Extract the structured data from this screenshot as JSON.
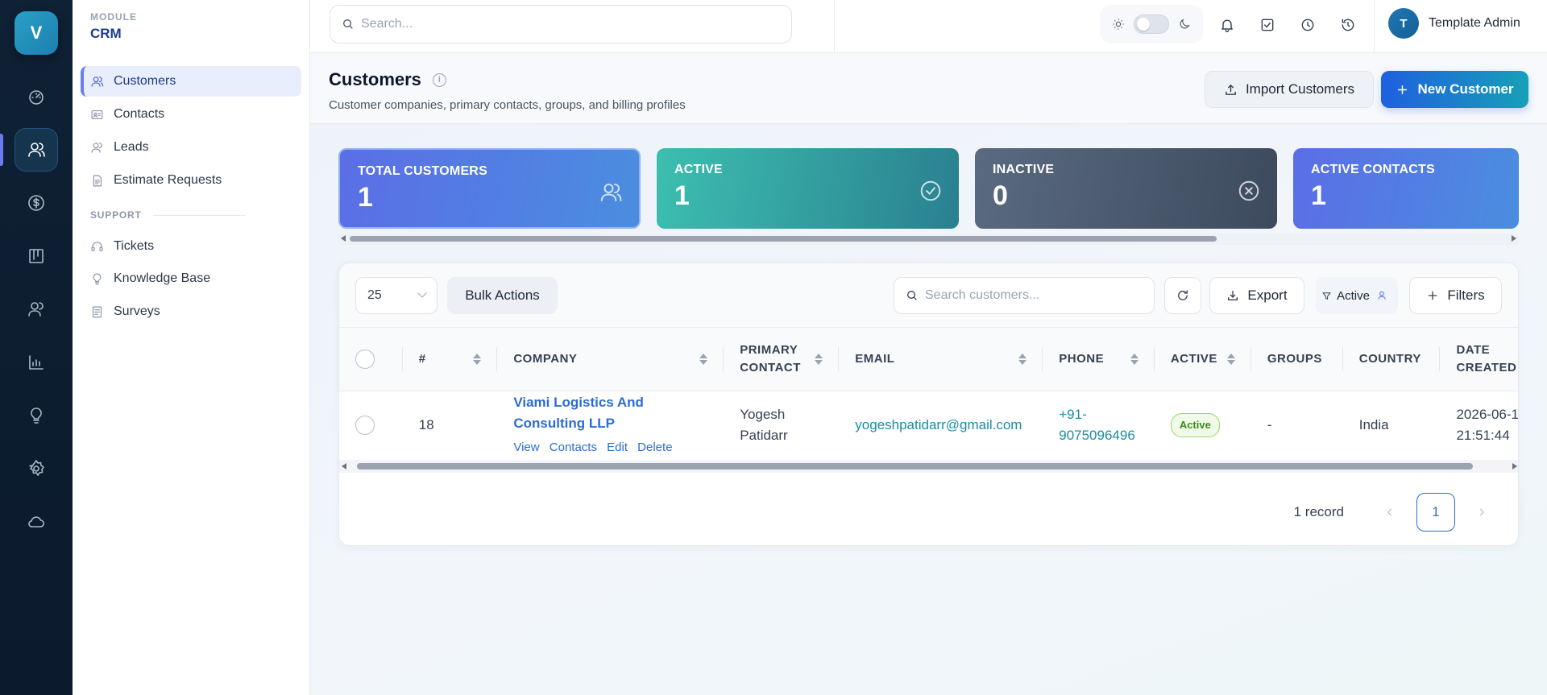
{
  "app": {
    "logo_letter": "V"
  },
  "rail": {
    "items": [
      {
        "icon": "dashboard-icon"
      },
      {
        "icon": "customers-icon",
        "active": true
      },
      {
        "icon": "dollar-icon"
      },
      {
        "icon": "kanban-icon"
      },
      {
        "icon": "users-icon"
      },
      {
        "icon": "chart-icon"
      },
      {
        "icon": "lightbulb-icon"
      },
      {
        "icon": "gear-icon"
      },
      {
        "icon": "cloud-icon"
      }
    ]
  },
  "sidebar": {
    "module_label": "MODULE",
    "module_name": "CRM",
    "items": [
      {
        "label": "Customers",
        "icon": "customers-icon",
        "active": true
      },
      {
        "label": "Contacts",
        "icon": "contact-card-icon"
      },
      {
        "label": "Leads",
        "icon": "leads-icon"
      },
      {
        "label": "Estimate Requests",
        "icon": "document-icon"
      }
    ],
    "support_label": "SUPPORT",
    "support_items": [
      {
        "label": "Tickets",
        "icon": "headset-icon"
      },
      {
        "label": "Knowledge Base",
        "icon": "lightbulb-icon"
      },
      {
        "label": "Surveys",
        "icon": "survey-icon"
      }
    ]
  },
  "topbar": {
    "search_placeholder": "Search...",
    "user_initial": "T",
    "user_name": "Template Admin"
  },
  "header": {
    "title": "Customers",
    "subtitle": "Customer companies, primary contacts, groups, and billing profiles",
    "import_label": "Import Customers",
    "new_label": "New Customer"
  },
  "stats": [
    {
      "label": "TOTAL CUSTOMERS",
      "value": "1"
    },
    {
      "label": "ACTIVE",
      "value": "1"
    },
    {
      "label": "INACTIVE",
      "value": "0"
    },
    {
      "label": "ACTIVE CONTACTS",
      "value": "1"
    }
  ],
  "toolbar": {
    "page_size": "25",
    "bulk_label": "Bulk Actions",
    "search_placeholder": "Search customers...",
    "export_label": "Export",
    "filter_chip": "Active",
    "filters_label": "Filters"
  },
  "table": {
    "columns": [
      "#",
      "COMPANY",
      "PRIMARY CONTACT",
      "EMAIL",
      "PHONE",
      "ACTIVE",
      "GROUPS",
      "COUNTRY",
      "DATE CREATED"
    ],
    "columns_display": {
      "num": "#",
      "company": "COMPANY",
      "primary_l1": "PRIMARY",
      "primary_l2": "CONTACT",
      "email": "EMAIL",
      "phone": "PHONE",
      "active": "ACTIVE",
      "groups": "GROUPS",
      "country": "COUNTRY",
      "date_l1": "DATE",
      "date_l2": "CREATED"
    },
    "rows": [
      {
        "id": "18",
        "company": "Viami Logistics And Consulting LLP",
        "actions": [
          "View",
          "Contacts",
          "Edit",
          "Delete"
        ],
        "contact_l1": "Yogesh",
        "contact_l2": "Patidarr",
        "email": "yogeshpatidarr@gmail.com",
        "phone_l1": "+91-",
        "phone_l2": "9075096496",
        "active": "Active",
        "groups": "-",
        "country": "India",
        "date_l1": "2026-06-1",
        "date_l2": "21:51:44"
      }
    ]
  },
  "pagination": {
    "records": "1 record",
    "current_page": "1"
  },
  "colors": {
    "accent": "#2b6cd4",
    "teal": "#1a8ea0",
    "rail_bg": "#0f2135",
    "success": "#3a8c1a"
  }
}
